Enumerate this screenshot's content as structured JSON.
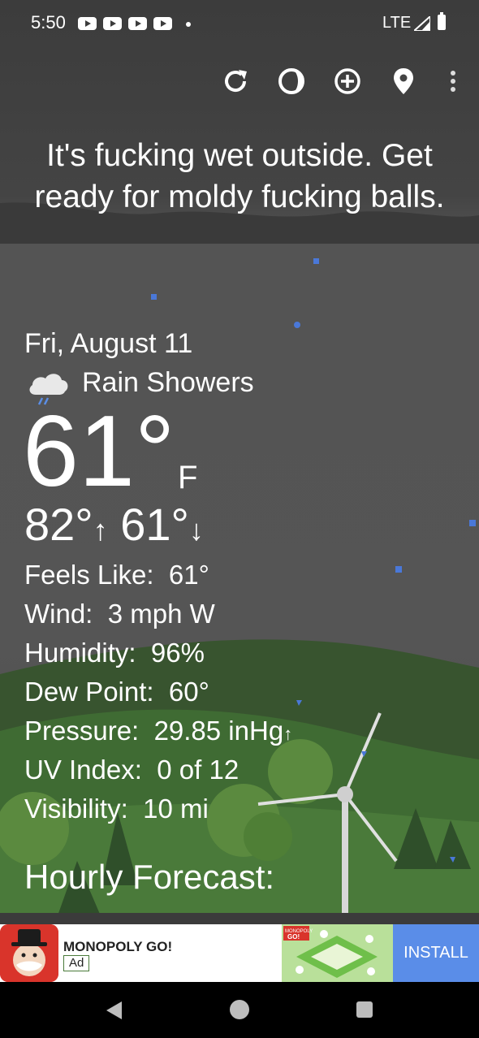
{
  "status_bar": {
    "time": "5:50",
    "network": "LTE",
    "notification_icons": [
      "youtube-icon",
      "youtube-icon",
      "youtube-icon",
      "youtube-icon"
    ]
  },
  "toolbar": {
    "icons": [
      "refresh-icon",
      "theme-icon",
      "add-location-icon",
      "location-pin-icon",
      "more-options-icon"
    ]
  },
  "headline": "It's fucking wet outside. Get ready for moldy fucking balls.",
  "weather": {
    "date": "Fri, August 11",
    "condition": "Rain Showers",
    "condition_icon": "rain-cloud-icon",
    "temperature": "61°",
    "unit": "F",
    "high": "82°",
    "low": "61°",
    "details": [
      {
        "label": "Feels Like:",
        "value": "61°"
      },
      {
        "label": "Wind:",
        "value": "3 mph W"
      },
      {
        "label": "Humidity:",
        "value": "96%"
      },
      {
        "label": "Dew Point:",
        "value": "60°"
      },
      {
        "label": "Pressure:",
        "value": "29.85 inHg"
      },
      {
        "label": "UV Index:",
        "value": "0 of 12"
      },
      {
        "label": "Visibility:",
        "value": "10 mi"
      }
    ],
    "hourly_title": "Hourly Forecast:"
  },
  "ad": {
    "title": "MONOPOLY GO!",
    "badge": "Ad",
    "install_label": "INSTALL",
    "art_text": "MONOPOLY GO!"
  },
  "colors": {
    "background": "#555555",
    "hill": "#3f6b33",
    "install_button": "#5a8de8"
  }
}
